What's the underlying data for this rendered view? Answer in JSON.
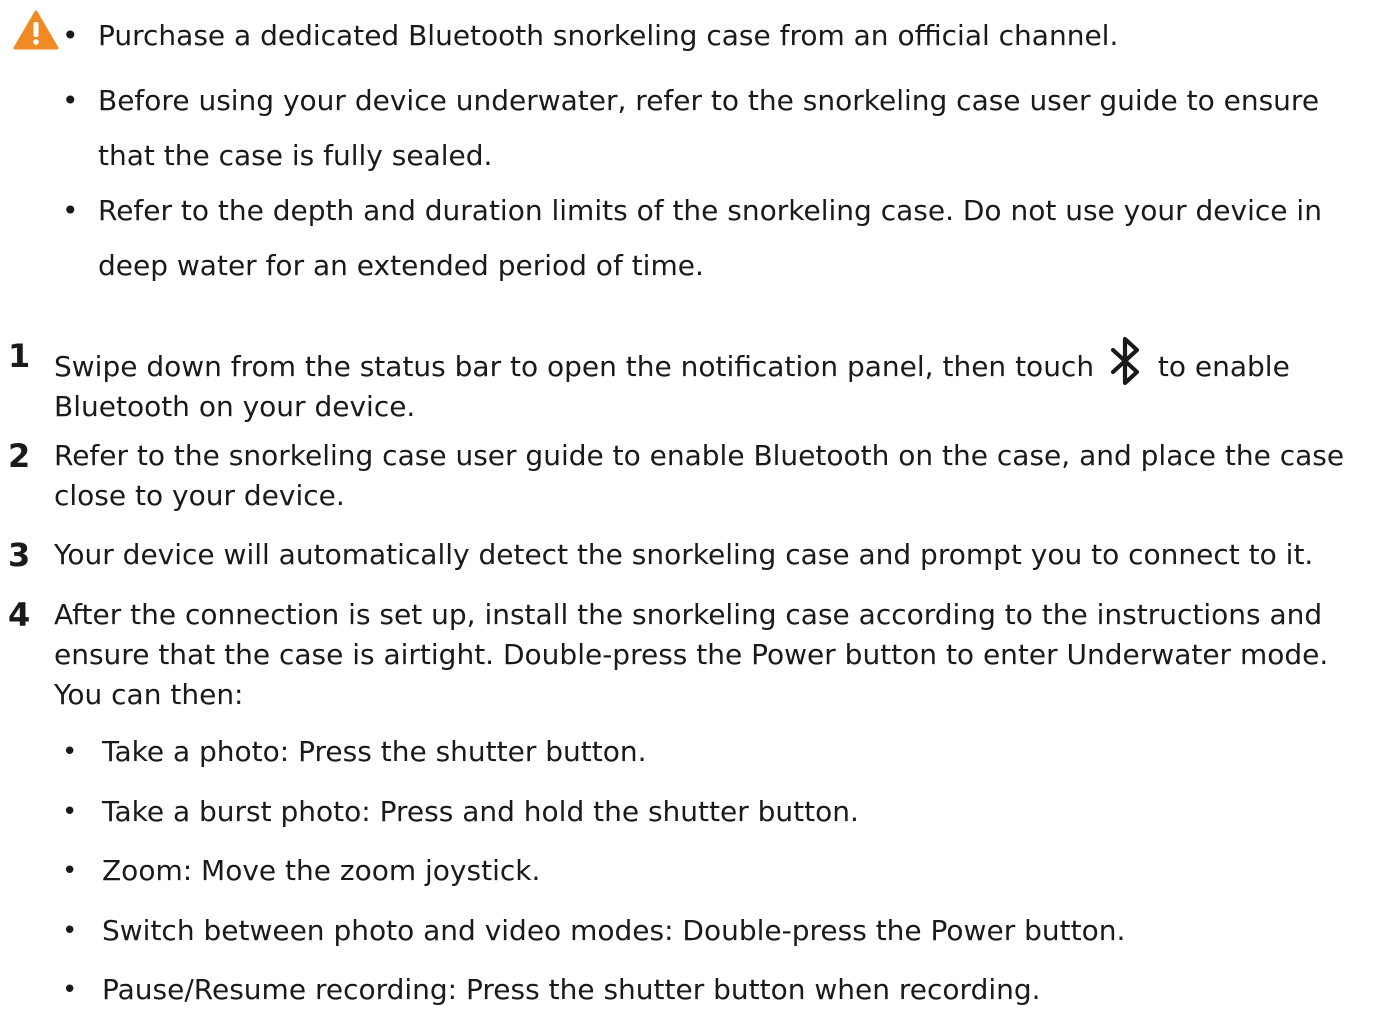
{
  "warnings": [
    "Purchase a dedicated Bluetooth snorkeling case from an official channel.",
    "Before using your device underwater, refer to the snorkeling case user guide to ensure that the case is fully sealed.",
    "Refer to the depth and duration limits of the snorkeling case. Do not use your device in deep water for an extended period of time."
  ],
  "steps": [
    {
      "num": "1",
      "before": "Swipe down from the status bar to open the notification panel, then touch",
      "after": "to enable Bluetooth on your device."
    },
    {
      "num": "2",
      "text": "Refer to the snorkeling case user guide to enable Bluetooth on the case, and place the case close to your device."
    },
    {
      "num": "3",
      "text": "Your device will automatically detect the snorkeling case and prompt you to connect to it."
    },
    {
      "num": "4",
      "text": "After the connection is set up, install the snorkeling case according to the instructions and ensure that the case is airtight. Double-press the Power button to enter Underwater mode. You can then:"
    }
  ],
  "subitems": [
    "Take a photo: Press the shutter button.",
    "Take a burst photo: Press and hold the shutter button.",
    "Zoom: Move the zoom joystick.",
    "Switch between photo and video modes: Double-press the Power button.",
    "Pause/Resume recording: Press the shutter button when recording."
  ],
  "bullet": "•",
  "icons": {
    "warning": "warning-triangle-icon",
    "bluetooth": "bluetooth-icon"
  },
  "colors": {
    "warning_icon": "#f08a24",
    "text": "#1a1a1a"
  }
}
